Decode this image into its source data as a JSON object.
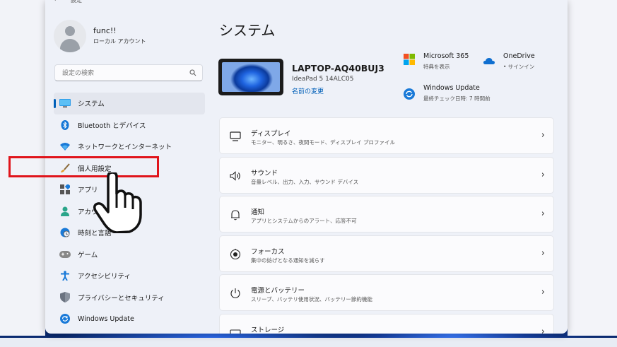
{
  "window": {
    "title": "設定"
  },
  "profile": {
    "name": "func!!",
    "account_type": "ローカル アカウント"
  },
  "search": {
    "placeholder": "設定の検索"
  },
  "nav": {
    "items": [
      {
        "label": "システム",
        "icon": "system-icon"
      },
      {
        "label": "Bluetooth とデバイス",
        "icon": "bluetooth-icon"
      },
      {
        "label": "ネットワークとインターネット",
        "icon": "wifi-icon"
      },
      {
        "label": "個人用設定",
        "icon": "brush-icon"
      },
      {
        "label": "アプリ",
        "icon": "apps-icon"
      },
      {
        "label": "アカウント",
        "icon": "accounts-icon"
      },
      {
        "label": "時刻と言語",
        "icon": "globe-clock-icon"
      },
      {
        "label": "ゲーム",
        "icon": "gamepad-icon"
      },
      {
        "label": "アクセシビリティ",
        "icon": "accessibility-icon"
      },
      {
        "label": "プライバシーとセキュリティ",
        "icon": "shield-icon"
      },
      {
        "label": "Windows Update",
        "icon": "update-icon"
      }
    ],
    "selected": "システム",
    "highlighted": "個人用設定"
  },
  "main": {
    "title": "システム",
    "device": {
      "name": "LAPTOP-AQ40BUJ3",
      "model": "IdeaPad 5 14ALC05",
      "rename_link": "名前の変更"
    },
    "quick_links": {
      "m365": {
        "title": "Microsoft 365",
        "subtitle": "特典を表示"
      },
      "onedrive": {
        "title": "OneDrive",
        "subtitle": "• サインイン"
      },
      "update": {
        "title": "Windows Update",
        "subtitle": "最終チェック日時: 7 時間前"
      }
    },
    "cards": [
      {
        "title": "ディスプレイ",
        "subtitle": "モニター、明るさ、夜間モード、ディスプレイ プロファイル",
        "icon": "display-icon"
      },
      {
        "title": "サウンド",
        "subtitle": "音量レベル、出力、入力、サウンド デバイス",
        "icon": "speaker-icon"
      },
      {
        "title": "通知",
        "subtitle": "アプリとシステムからのアラート、応答不可",
        "icon": "bell-icon"
      },
      {
        "title": "フォーカス",
        "subtitle": "集中の妨げとなる通知を減らす",
        "icon": "focus-icon"
      },
      {
        "title": "電源とバッテリー",
        "subtitle": "スリープ、バッテリ使用状況、バッテリー節約機能",
        "icon": "power-icon"
      },
      {
        "title": "ストレージ",
        "subtitle": "",
        "icon": "storage-icon"
      }
    ]
  },
  "colors": {
    "accent": "#005fb8",
    "highlight": "#e0141b",
    "window_bg": "#eef1f8",
    "card_bg": "#fbfbfd"
  }
}
